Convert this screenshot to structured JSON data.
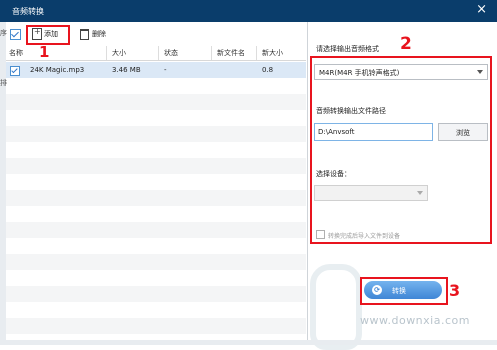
{
  "window": {
    "title": "音频转换",
    "close_glyph": "×"
  },
  "background": {
    "left_char_1": "序",
    "left_char_2": "排"
  },
  "toolbar": {
    "add_label": "添加",
    "delete_label": "删除"
  },
  "table": {
    "columns": [
      "名称",
      "大小",
      "状态",
      "新文件名",
      "新大小"
    ],
    "rows": [
      {
        "checked": true,
        "name": "24K Magic.mp3",
        "size": "3.46 MB",
        "status": "-",
        "new_name": "",
        "new_size": "0.8"
      }
    ]
  },
  "panel": {
    "format_label": "请选择输出音频格式",
    "format_value": "M4R(M4R 手机铃声格式)",
    "path_label": "音频转换输出文件路径",
    "path_value": "D:\\Anvsoft",
    "browse_label": "浏览",
    "device_label": "选择设备：",
    "device_value": "",
    "import_label": "转换完成后导入文件到设备",
    "convert_label": "转换"
  },
  "annotations": {
    "n1": "1",
    "n2": "2",
    "n3": "3"
  },
  "watermark": {
    "text": "www.downxia.com"
  },
  "colors": {
    "titlebar": "#0a3d6b",
    "annotation": "#e8141e",
    "convert_button": "#3f86d6"
  }
}
